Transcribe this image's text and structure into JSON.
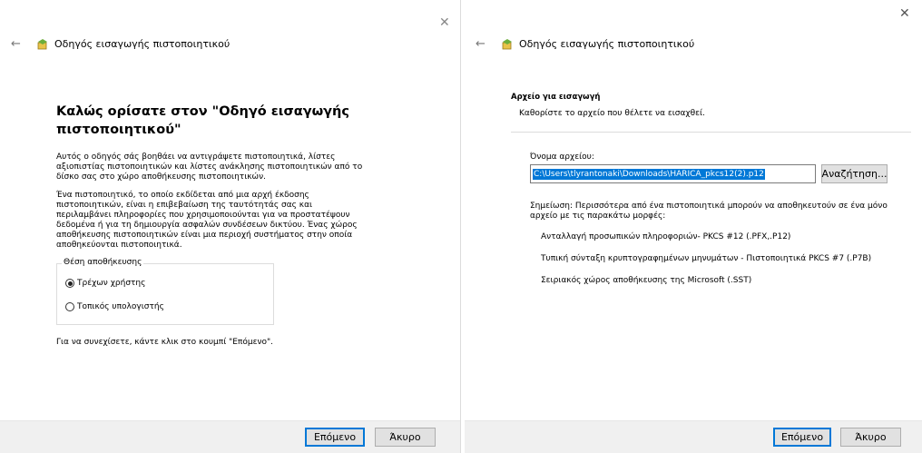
{
  "left": {
    "header_title": "Οδηγός εισαγωγής πιστοποιητικού",
    "welcome_title": "Καλώς ορίσατε στον \"Οδηγό εισαγωγής πιστοποιητικού\"",
    "paragraph1": "Αυτός ο οδηγός σάς βοηθάει να αντιγράψετε πιστοποιητικά, λίστες αξιοπιστίας πιστοποιητικών και λίστες ανάκλησης πιστοποιητικών από το δίσκο σας στο χώρο αποθήκευσης πιστοποιητικών.",
    "paragraph2": "Ένα πιστοποιητικό, το οποίο εκδίδεται από μια αρχή έκδοσης πιστοποιητικών, είναι η επιβεβαίωση της ταυτότητάς σας και περιλαμβάνει πληροφορίες που χρησιμοποιούνται για να προστατέψουν δεδομένα ή για τη δημιουργία ασφαλών συνδέσεων δικτύου. Ένας χώρος αποθήκευσης πιστοποιητικών είναι μια περιοχή συστήματος στην οποία αποθηκεύονται πιστοποιητικά.",
    "store_location_label": "Θέση αποθήκευσης",
    "radio_current_user": "Τρέχων χρήστης",
    "radio_local_machine": "Τοπικός υπολογιστής",
    "continue_hint": "Για να συνεχίσετε, κάντε κλικ στο κουμπί \"Επόμενο\".",
    "next_label": "Επόμενο",
    "cancel_label": "Άκυρο"
  },
  "right": {
    "header_title": "Οδηγός εισαγωγής πιστοποιητικού",
    "section_title": "Αρχείο για εισαγωγή",
    "section_subtitle": "Καθορίστε το αρχείο που θέλετε να εισαχθεί.",
    "filename_label": "Όνομα αρχείου:",
    "filename_value": "C:\\Users\\tlyrantonaki\\Downloads\\HARICA_pkcs12(2).p12",
    "browse_label": "Αναζήτηση...",
    "note": "Σημείωση:  Περισσότερα από ένα πιστοποιητικά μπορούν να αποθηκευτούν σε ένα μόνο αρχείο με τις παρακάτω μορφές:",
    "formats": [
      "Ανταλλαγή προσωπικών πληροφοριών- PKCS #12 (.PFX,.P12)",
      "Τυπική σύνταξη κρυπτογραφημένων μηνυμάτων - Πιστοποιητικά PKCS #7 (.P7B)",
      "Σειριακός χώρος αποθήκευσης της Microsoft (.SST)"
    ],
    "next_label": "Επόμενο",
    "cancel_label": "Άκυρο"
  },
  "icons": {
    "close": "close-icon",
    "back": "back-arrow-icon",
    "wizard": "certificate-wizard-icon"
  },
  "colors": {
    "accent": "#0078d7",
    "footer_bg": "#f0f0f0"
  }
}
